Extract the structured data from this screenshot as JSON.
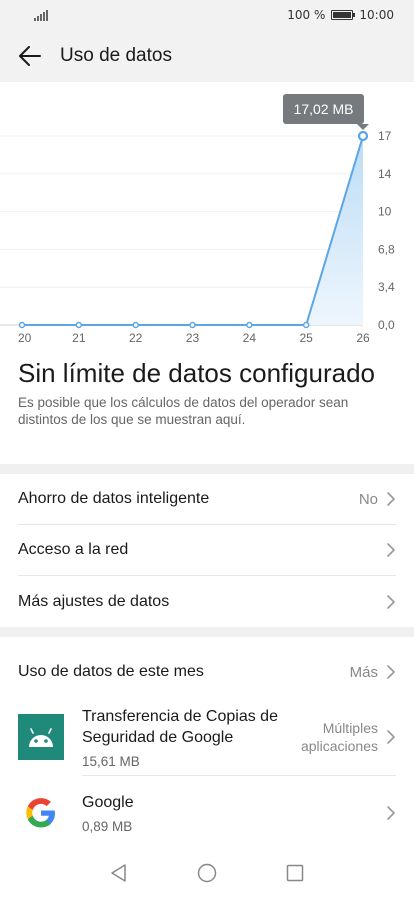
{
  "status": {
    "battery": "100 %",
    "time": "10:00"
  },
  "header": {
    "title": "Uso de datos"
  },
  "chart_data": {
    "type": "area",
    "categories": [
      "20",
      "21",
      "22",
      "23",
      "24",
      "25",
      "26"
    ],
    "values": [
      0,
      0,
      0,
      0,
      0,
      0,
      17.02
    ],
    "y_ticks": [
      "17",
      "14",
      "10",
      "6,8",
      "3,4",
      "0,0"
    ],
    "ylim": [
      0,
      17
    ],
    "tooltip": "17,02 MB",
    "colors": {
      "line": "#5aa6e6",
      "fill_top": "#bcdcf6",
      "fill_bottom": "#eef6fd"
    }
  },
  "summary": {
    "title": "Sin límite de datos configurado",
    "note": "Es posible que los cálculos de datos del operador sean distintos de los que se muestran aquí."
  },
  "settings": [
    {
      "label": "Ahorro de datos inteligente",
      "value": "No"
    },
    {
      "label": "Acceso a la red",
      "value": ""
    },
    {
      "label": "Más ajustes de datos",
      "value": ""
    }
  ],
  "usage": {
    "title": "Uso de datos de este mes",
    "more": "Más",
    "apps": [
      {
        "name": "Transferencia de Copias de Seguridad de Google",
        "size": "15,61 MB",
        "detail": "Múltiples aplicaciones",
        "icon": "android-icon"
      },
      {
        "name": "Google",
        "size": "0,89 MB",
        "detail": "",
        "icon": "google-g-icon"
      }
    ]
  }
}
